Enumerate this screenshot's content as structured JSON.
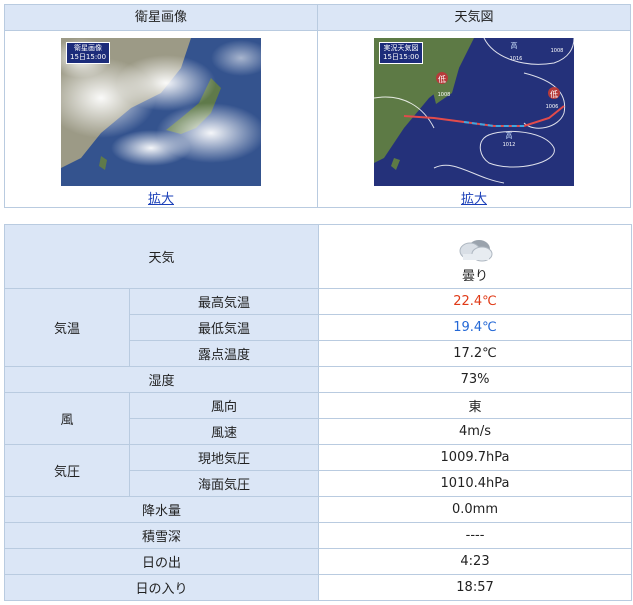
{
  "images": {
    "satellite": {
      "header": "衛星画像",
      "caption_title": "衛星画像",
      "caption_time": "15日15:00",
      "zoom_label": "拡大"
    },
    "weather_map": {
      "header": "天気図",
      "caption_title": "実況天気図",
      "caption_time": "15日15:00",
      "zoom_label": "拡大",
      "map_labels": {
        "low": "低",
        "high": "高",
        "pressure_values": [
          "1008",
          "1006",
          "1016",
          "1008",
          "1012"
        ]
      }
    }
  },
  "observation": {
    "weather": {
      "label": "天気",
      "value": "曇り",
      "icon": "cloudy-icon"
    },
    "temperature": {
      "group_label": "気温",
      "max": {
        "label": "最高気温",
        "value": "22.4℃",
        "color": "#e03a17"
      },
      "min": {
        "label": "最低気温",
        "value": "19.4℃",
        "color": "#2468d6"
      },
      "dew": {
        "label": "露点温度",
        "value": "17.2℃"
      }
    },
    "humidity": {
      "label": "湿度",
      "value": "73%"
    },
    "wind": {
      "group_label": "風",
      "direction": {
        "label": "風向",
        "value": "東"
      },
      "speed": {
        "label": "風速",
        "value": "4m/s"
      }
    },
    "pressure": {
      "group_label": "気圧",
      "station": {
        "label": "現地気圧",
        "value": "1009.7hPa"
      },
      "sea": {
        "label": "海面気圧",
        "value": "1010.4hPa"
      }
    },
    "precipitation": {
      "label": "降水量",
      "value": "0.0mm"
    },
    "snow_depth": {
      "label": "積雪深",
      "value": "----"
    },
    "sunrise": {
      "label": "日の出",
      "value": "4:23"
    },
    "sunset": {
      "label": "日の入り",
      "value": "18:57"
    }
  }
}
